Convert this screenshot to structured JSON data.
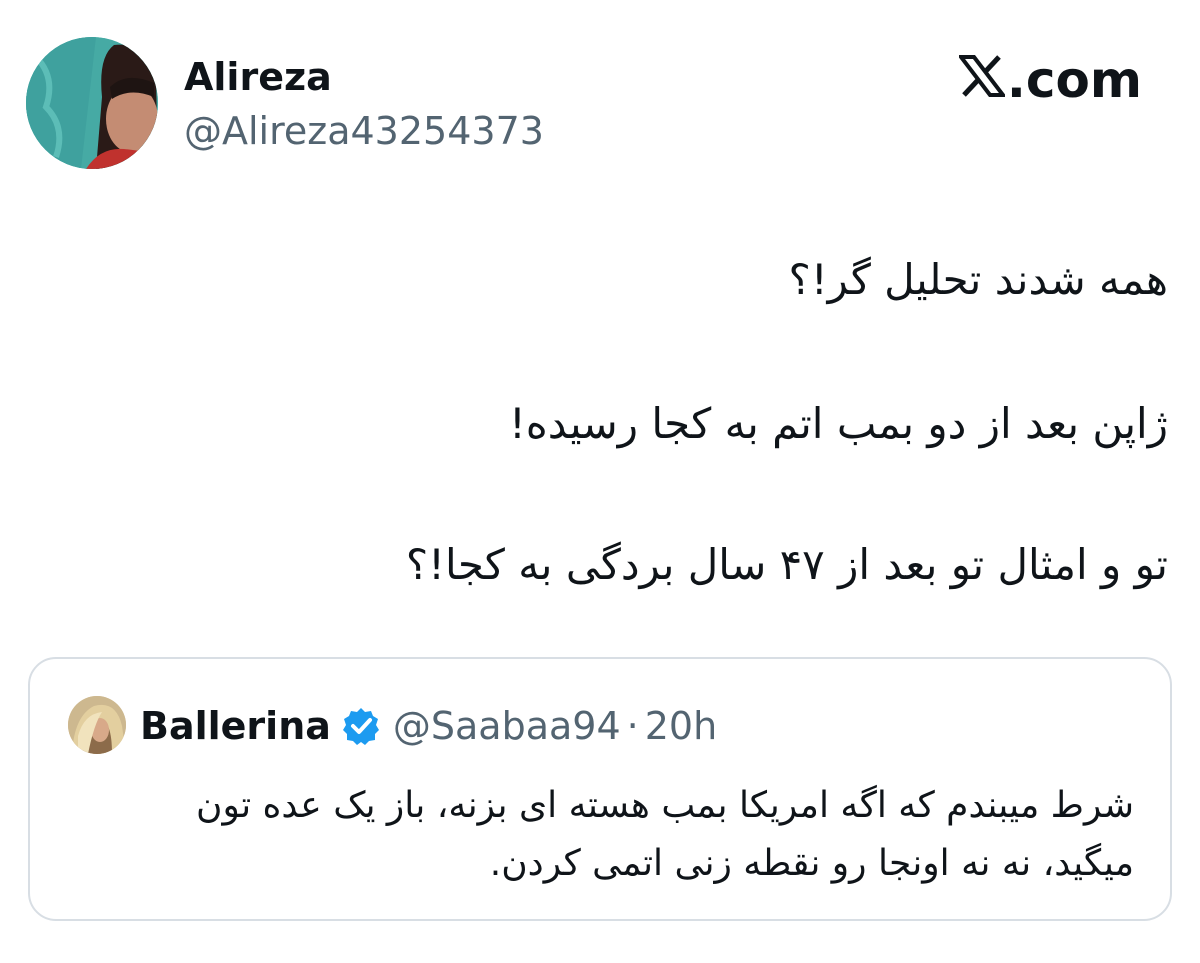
{
  "tweet": {
    "author": {
      "name": "Alireza",
      "handle": "@Alireza43254373"
    },
    "brand": {
      "logo": "x-logo",
      "suffix": ".com"
    },
    "lines": [
      "همه شدند تحلیل گر!؟",
      "ژاپن بعد از دو بمب اتم به کجا رسیده!",
      "تو و امثال تو بعد از ۴۷ سال بردگی به کجا!؟"
    ]
  },
  "quote": {
    "name": "Ballerina",
    "verified_icon": "verified-badge-icon",
    "handle": "@Saabaa94",
    "separator": "·",
    "time": "20h",
    "lines": [
      "شرط میبندم که اگه امریکا بمب هسته ای بزنه، باز یک عده تون",
      "میگید، نه نه اونجا رو نقطه زنی اتمی کردن."
    ]
  },
  "colors": {
    "text": "#0f1419",
    "secondary": "#536471",
    "border": "#d8dee4",
    "verified": "#1d9bf0"
  }
}
